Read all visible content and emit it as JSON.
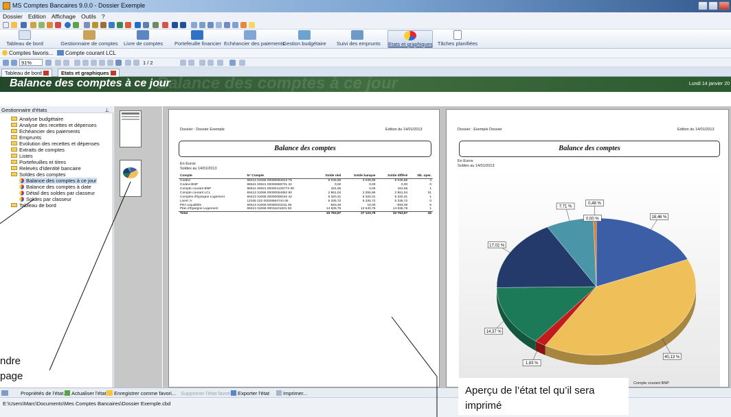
{
  "window": {
    "title": "MS Comptes Bancaires 9.0.0 - Dossier Exemple"
  },
  "menu": [
    "Dossier",
    "Edition",
    "Affichage",
    "Outils",
    "?"
  ],
  "ribbon": [
    {
      "label": "Tableau de bord",
      "icon": "dashboard-icon"
    },
    {
      "label": "Gestionnaire de comptes",
      "icon": "bank-icon"
    },
    {
      "label": "Livre de comptes",
      "icon": "book-icon"
    },
    {
      "label": "Portefeuille financier",
      "icon": "portfolio-icon"
    },
    {
      "label": "Echéancier des paiements",
      "icon": "schedule-icon"
    },
    {
      "label": "Gestion budgétaire",
      "icon": "budget-icon"
    },
    {
      "label": "Suivi des emprunts",
      "icon": "loan-icon"
    },
    {
      "label": "Etats et graphiques",
      "icon": "chart-icon"
    },
    {
      "label": "Tâches planifiées",
      "icon": "tasks-icon"
    }
  ],
  "favbar": {
    "favorites": "Comptes favoris...",
    "current": "Compte courant LCL"
  },
  "preview_toolbar": {
    "zoom": "91%",
    "pages": "1 / 2"
  },
  "tabs": [
    "Tableau de bord",
    "Etats et graphiques"
  ],
  "banner": {
    "title": "Balance des comptes à ce jour",
    "date": "Lundi 14 janvier 20"
  },
  "tree": {
    "header": "Gestionnaire d'états",
    "items": [
      "Analyse budgétaire",
      "Analyse des recettes et dépenses",
      "Echéancier des paiements",
      "Emprunts",
      "Evolution des recettes et dépenses",
      "Extraits de comptes",
      "Listes",
      "Portefeuilles et titres",
      "Relevés d'identité bancaire",
      "Soldes des comptes"
    ],
    "subitems": [
      "Balance des comptes à ce jour",
      "Balance des comptes à date",
      "Détail des soldes par classeur",
      "Soldes par classeur"
    ],
    "last": "Tableau de bord"
  },
  "page1": {
    "dossier": "Dossier : Dossier Exemple",
    "edition": "Edition du 14/01/2013",
    "title": "Balance des comptes",
    "currency": "En Euros",
    "soldes": "Soldes au 14/01/2013",
    "columns": [
      "Compte",
      "N° Compte",
      "Solde réel",
      "Solde banque",
      "Solde différé",
      "Nb. oper."
    ],
    "rows": [
      [
        "Codevi",
        "69413 31066 00000054813 75",
        "5 046,86",
        "3 046,86",
        "5 046,86",
        "4"
      ],
      [
        "Codevi BNP",
        "96541 00021 00000859701 32",
        "0,00",
        "0,00",
        "0,00",
        "0"
      ],
      [
        "Compte courant BNP",
        "96541 00021 00000412577X 90",
        "181,65",
        "3,05",
        "181,65",
        "1"
      ],
      [
        "Compte courant LCL",
        "69413 31066 00000054852 90",
        "2 861,04",
        "2 255,96",
        "2 861,04",
        "31"
      ],
      [
        "Comptes d'Epargne Logement",
        "69413 31066 00000058164 42",
        "6 320,31",
        "6 320,31",
        "6 320,31",
        "1"
      ],
      [
        "Livret 'A'",
        "12345 222 00028584744 05",
        "5 335,72",
        "5 335,72",
        "5 335,72",
        "0"
      ],
      [
        "PEA Liquidités",
        "69413 31066 00000023211 65",
        "-593,49",
        "10,00",
        "-593,49",
        "6"
      ],
      [
        "Plan d'Epargne Logement",
        "69413 31066 00011101631 63",
        "14 836,76",
        "13 540,76",
        "14 836,76",
        "1"
      ]
    ],
    "total": [
      "Total",
      "",
      "33 763,97",
      "27 123,79",
      "33 763,97",
      "46"
    ]
  },
  "page2": {
    "dossier": "Dossier : Exemple Dossier",
    "edition": "Edition du 14/01/2013",
    "title": "Balance des comptes",
    "currency": "En Euros",
    "soldes": "Soldes au 14/01/2013",
    "legend_fragment": "Compte courant BNP"
  },
  "chart_data": {
    "type": "pie",
    "title": "",
    "slices": [
      {
        "label": "18,46 %",
        "value": 18.46,
        "color": "#3b5ea7"
      },
      {
        "label": "40,13 %",
        "value": 40.13,
        "color": "#efbf5a"
      },
      {
        "label": "1,83 %",
        "value": 1.83,
        "color": "#c21b1b"
      },
      {
        "label": "14,37 %",
        "value": 14.37,
        "color": "#1c7a58"
      },
      {
        "label": "17,02 %",
        "value": 17.02,
        "color": "#233a6b"
      },
      {
        "label": "7,71 %",
        "value": 7.71,
        "color": "#4a95a8"
      },
      {
        "label": "0,48 %",
        "value": 0.48,
        "color": "#e07a2a"
      }
    ],
    "extra_labels": [
      "0,00 %"
    ]
  },
  "bottombar": {
    "properties": "Propriétés de l'état...",
    "refresh": "Actualiser l'état",
    "save_fav": "Enregistrer comme favori...",
    "remove_fav": "Supprimer l'état favori...",
    "export": "Exporter l'état",
    "print": "Imprimer..."
  },
  "status": {
    "path": "E:\\Users\\Marc\\Documents\\Mes Comptes Bancaires\\Dossier Exemple.cbd"
  },
  "callouts": {
    "left_a": "ndre",
    "left_b": "page",
    "right": "Aperçu de l’état tel qu’il sera imprimé"
  }
}
